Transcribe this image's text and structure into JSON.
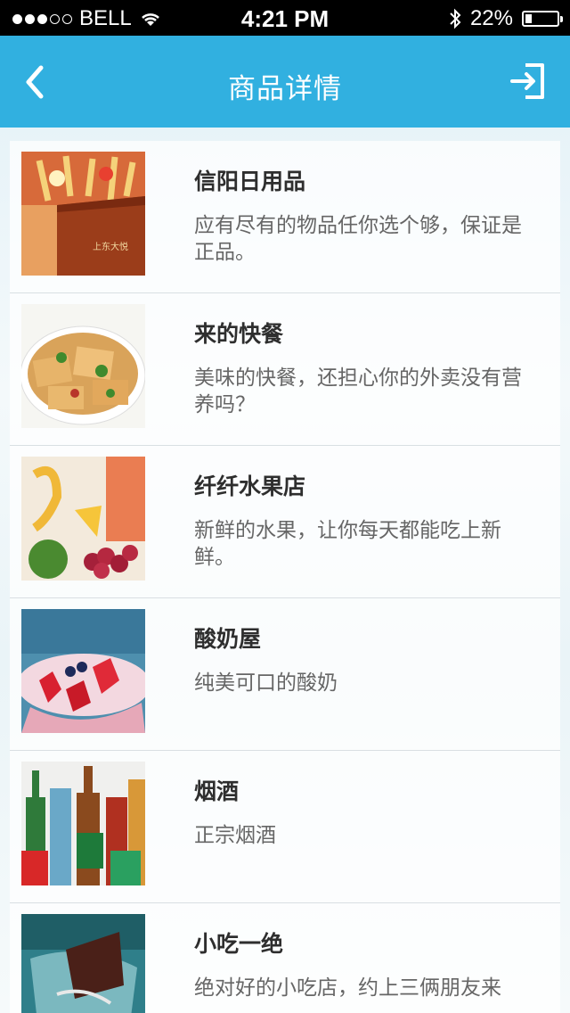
{
  "status_bar": {
    "carrier": "BELL",
    "time": "4:21 PM",
    "battery_percent_text": "22%",
    "battery_level": 0.22,
    "signal_bars_filled": 3,
    "signal_bars_total": 5
  },
  "header": {
    "title": "商品详情",
    "back_icon": "chevron-left-icon",
    "exit_icon": "exit-icon",
    "background_color": "#31b0e0"
  },
  "stores": [
    {
      "name": "信阳日用品",
      "description": "应有尽有的物品任你选个够，保证是正品。",
      "image": "daily-goods-image",
      "image_text": "上东大悦"
    },
    {
      "name": "来的快餐",
      "description": "美味的快餐，还担心你的外卖没有营养吗？",
      "image": "fast-food-image"
    },
    {
      "name": "纤纤水果店",
      "description": "新鲜的水果，让你每天都能吃上新鲜。",
      "image": "fruit-image"
    },
    {
      "name": "酸奶屋",
      "description": "纯美可口的酸奶",
      "image": "yogurt-image"
    },
    {
      "name": "烟酒",
      "description": "正宗烟酒",
      "image": "drinks-image"
    },
    {
      "name": "小吃一绝",
      "description": "绝对好的小吃店，约上三俩朋友来",
      "image": "snack-image"
    }
  ]
}
